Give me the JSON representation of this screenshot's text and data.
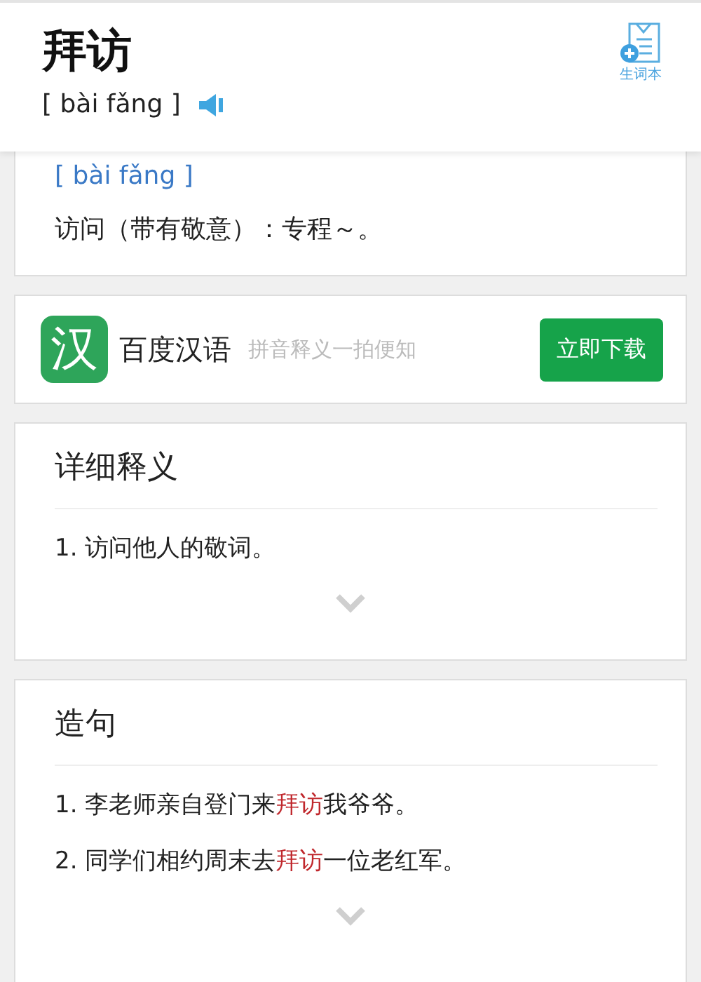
{
  "header": {
    "word": "拜访",
    "pinyin": "[ bài fǎng ]",
    "wordbook_label": "生词本"
  },
  "basic": {
    "pinyin": "[ bài fǎng ]",
    "definition": "访问（带有敬意）：专程～。"
  },
  "ad": {
    "logo_char": "汉",
    "app_name": "百度汉语",
    "slogan": "拼音释义一拍便知",
    "button": "立即下载"
  },
  "detail": {
    "title": "详细释义",
    "items": [
      "1. 访问他人的敬词。"
    ]
  },
  "sentences": {
    "title": "造句",
    "items": [
      [
        {
          "text": "1. 李老师亲自登门来",
          "highlight": false
        },
        {
          "text": "拜访",
          "highlight": true
        },
        {
          "text": "我爷爷。",
          "highlight": false
        }
      ],
      [
        {
          "text": "2. 同学们相约周末去",
          "highlight": false
        },
        {
          "text": "拜访",
          "highlight": true
        },
        {
          "text": "一位老红军。",
          "highlight": false
        }
      ]
    ]
  }
}
